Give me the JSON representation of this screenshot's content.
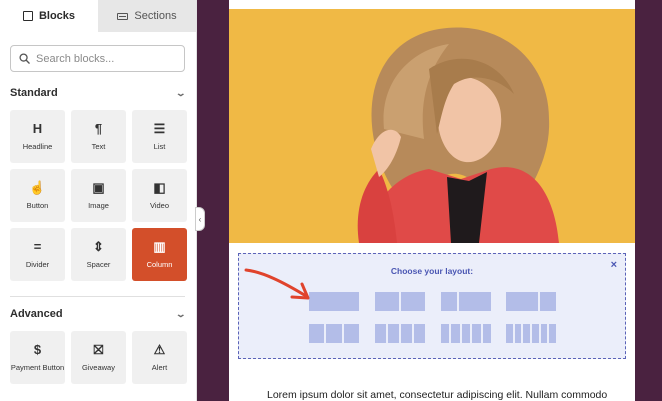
{
  "sidebar": {
    "tabs": [
      {
        "label": "Blocks",
        "active": true
      },
      {
        "label": "Sections",
        "active": false
      }
    ],
    "search": {
      "placeholder": "Search blocks..."
    },
    "groups": {
      "standard": {
        "title": "Standard",
        "blocks": [
          {
            "label": "Headline",
            "icon": "headline-icon",
            "glyph": "H"
          },
          {
            "label": "Text",
            "icon": "paragraph-icon",
            "glyph": "¶"
          },
          {
            "label": "List",
            "icon": "list-icon",
            "glyph": "☰"
          },
          {
            "label": "Button",
            "icon": "pointer-icon",
            "glyph": "☝"
          },
          {
            "label": "Image",
            "icon": "image-icon",
            "glyph": "▣"
          },
          {
            "label": "Video",
            "icon": "video-icon",
            "glyph": "◧"
          },
          {
            "label": "Divider",
            "icon": "divider-icon",
            "glyph": "="
          },
          {
            "label": "Spacer",
            "icon": "spacer-icon",
            "glyph": "⇕"
          },
          {
            "label": "Column",
            "icon": "column-icon",
            "glyph": "▥",
            "selected": true
          }
        ]
      },
      "advanced": {
        "title": "Advanced",
        "blocks": [
          {
            "label": "Payment Button",
            "icon": "payment-icon",
            "glyph": "$"
          },
          {
            "label": "Giveaway",
            "icon": "gift-icon",
            "glyph": "⛝"
          },
          {
            "label": "Alert",
            "icon": "alert-icon",
            "glyph": "⚠"
          }
        ]
      }
    }
  },
  "canvas": {
    "layout_picker": {
      "title": "Choose your layout:",
      "close": "×",
      "rows": [
        [
          [
            1
          ],
          [
            1,
            1
          ],
          [
            1,
            2
          ],
          [
            2,
            1
          ]
        ],
        [
          [
            1,
            1,
            1
          ],
          [
            1,
            1,
            1,
            1
          ],
          [
            1,
            1,
            1,
            1,
            1
          ],
          [
            1,
            1,
            1,
            1,
            1,
            1
          ]
        ]
      ]
    },
    "body_text": "Lorem ipsum dolor sit amet, consectetur adipiscing elit. Nullam commodo"
  },
  "colors": {
    "accent": "#d34f2a",
    "backdrop": "#4a2240",
    "layout_border": "#5b63b8",
    "layout_fill": "#b3bde8",
    "hero_bg": "#f0b945",
    "arrow": "#e0432c"
  }
}
